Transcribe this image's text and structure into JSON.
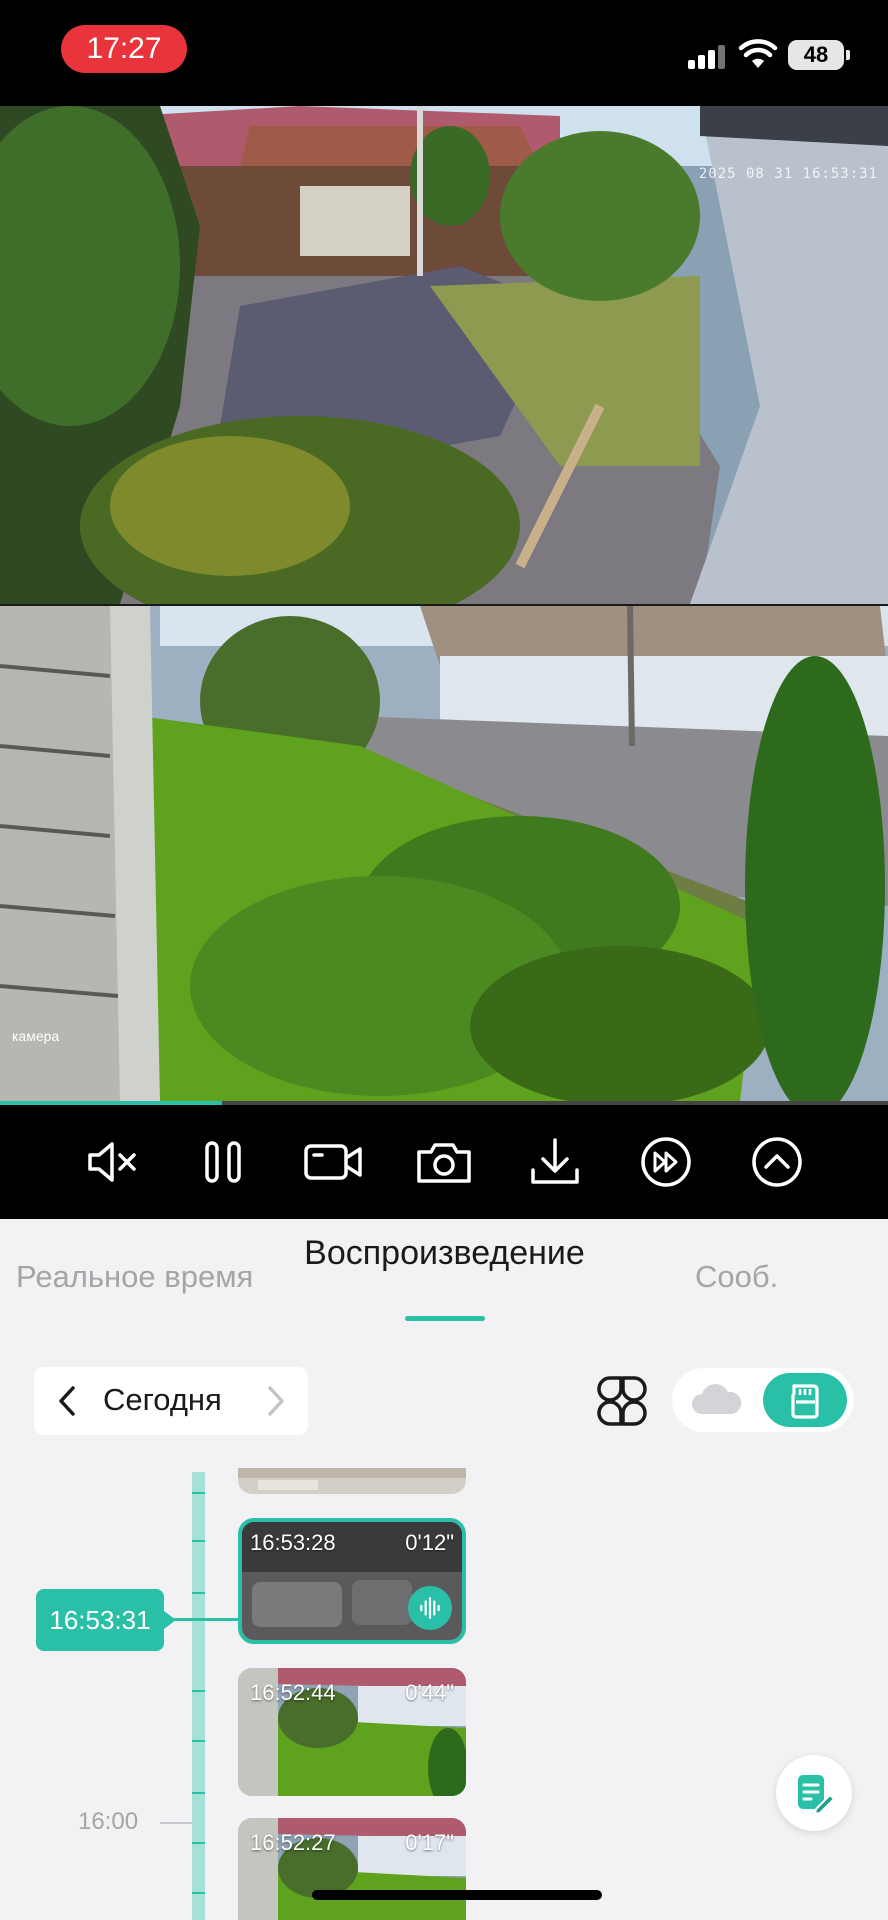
{
  "status_bar": {
    "time": "17:27",
    "battery": "48"
  },
  "feeds": {
    "top_overlay_time": "2025 08 31 16:53:31",
    "bottom_label": "камера"
  },
  "playback": {
    "progress": 0.25
  },
  "controls": [
    {
      "name": "mute-toggle",
      "icon": "speaker-muted-icon"
    },
    {
      "name": "pause",
      "icon": "pause-icon"
    },
    {
      "name": "record",
      "icon": "video-camera-icon"
    },
    {
      "name": "snapshot",
      "icon": "camera-icon"
    },
    {
      "name": "download",
      "icon": "download-icon"
    },
    {
      "name": "speed",
      "icon": "fast-forward-icon"
    },
    {
      "name": "collapse",
      "icon": "chevron-up-icon"
    }
  ],
  "tabs": {
    "live": "Реальное время",
    "playback": "Воспроизведение",
    "messages": "Сооб."
  },
  "date_selector": {
    "label": "Сегодня"
  },
  "timeline": {
    "current_time": "16:53:31",
    "hour_label": "16:00",
    "clips": [
      {
        "start": "",
        "duration": ""
      },
      {
        "start": "16:53:28",
        "duration": "0'12\"",
        "has_audio": true,
        "selected": true
      },
      {
        "start": "16:52:44",
        "duration": "0'44\""
      },
      {
        "start": "16:52:27",
        "duration": "0'17\""
      }
    ]
  },
  "colors": {
    "accent": "#2ac0a7",
    "status_time_bg": "#e8343a",
    "background": "#f2f2f4"
  }
}
